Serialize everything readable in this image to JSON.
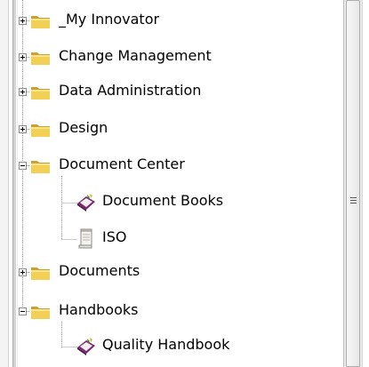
{
  "tree": {
    "items": [
      {
        "label": "_My Innovator",
        "type": "folder",
        "expanded": false
      },
      {
        "label": "Change Management",
        "type": "folder",
        "expanded": false
      },
      {
        "label": "Data Administration",
        "type": "folder",
        "expanded": false
      },
      {
        "label": "Design",
        "type": "folder",
        "expanded": false
      },
      {
        "label": "Document Center",
        "type": "folder",
        "expanded": true
      },
      {
        "label": "Document Books",
        "type": "book",
        "icon": "document-book-icon"
      },
      {
        "label": "ISO",
        "type": "scroll",
        "icon": "scroll-icon"
      },
      {
        "label": "Documents",
        "type": "folder",
        "expanded": false
      },
      {
        "label": "Handbooks",
        "type": "folder",
        "expanded": true
      },
      {
        "label": "Quality Handbook",
        "type": "book",
        "icon": "document-book-icon"
      }
    ]
  },
  "colors": {
    "folder": "#f2cf55",
    "folder_dark": "#c9a232",
    "book": "#7a2a6b"
  }
}
